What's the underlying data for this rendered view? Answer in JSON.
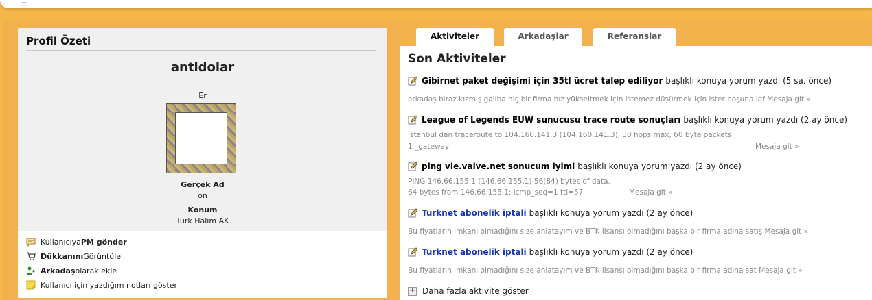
{
  "left_panel": {
    "title": "Profil Özeti",
    "username": "antidolar",
    "gender": "Er",
    "real_name_label": "Gerçek Ad",
    "real_name_value": "on",
    "location_label": "Konum",
    "location_value": "Türk Halim AK",
    "actions": [
      {
        "pre": "Kullanıcıya ",
        "bold": "PM gönder",
        "post": "",
        "icon": "message-icon"
      },
      {
        "pre": "",
        "bold": "Dükkanını",
        "post": " Görüntüle",
        "icon": "cart-icon"
      },
      {
        "pre": "",
        "bold": "Arkadaş",
        "post": " olarak ekle",
        "icon": "add-friend-icon"
      },
      {
        "pre": "Kullanıcı için yazdığım notları göster",
        "bold": "",
        "post": "",
        "icon": "note-icon"
      }
    ]
  },
  "tabs": [
    {
      "label": "Aktiviteler",
      "active": true
    },
    {
      "label": "Arkadaşlar",
      "active": false
    },
    {
      "label": "Referanslar",
      "active": false
    }
  ],
  "activity": {
    "title": "Son Aktiviteler",
    "items": [
      {
        "topic": "Gibirnet paket değişimi için 35tl ücret talep ediliyor",
        "suffix": "başlıklı konuya yorum yazdı (5 sa. önce)",
        "snippet": "arkadaş biraz kızmış galiba hiç bir firma hız yükseltmek için istemez düşürmek için ister boşuna laf Mesaja git »",
        "snippet2": "",
        "goto": ""
      },
      {
        "topic": "League of Legends EUW sunucusu trace route sonuçları",
        "suffix": "başlıklı konuya yorum yazdı (2 ay önce)",
        "snippet": "İstanbul dan traceroute to 104.160.141.3 (104.160.141.3), 30 hops max, 60 byte packets",
        "snippet2": "1 _gateway",
        "goto": "Mesaja git »"
      },
      {
        "topic": "ping vie.valve.net sonucum iyimi",
        "suffix": "başlıklı konuya yorum yazdı (2 ay önce)",
        "snippet": "PING 146.66.155.1 (146.66.155.1) 56(84) bytes of data.",
        "snippet2": "64 bytes from 146.66.155.1: icmp_seq=1 ttl=57",
        "goto": "Mesaja git »"
      },
      {
        "topic": "Turknet abonelik iptali",
        "suffix": "başlıklı konuya yorum yazdı (2 ay önce)",
        "snippet": "Bu fiyatların imkanı olmadığını size anlatayım ve BTK lisansı olmadığını başka bir firma adına satış Mesaja git »",
        "snippet2": "",
        "goto": ""
      },
      {
        "topic": "Turknet abonelik iptali",
        "suffix": "başlıklı konuya yorum yazdı (2 ay önce)",
        "snippet": "Bu fiyatların imkanı olmadığını size anlatayım ve BTK lisansı olmadığını başka bir firma adına sat Mesaja git »",
        "snippet2": "",
        "goto": ""
      }
    ],
    "more_label": "Daha fazla aktivite göster"
  },
  "colors": {
    "background": "#f5b64a",
    "link_blue": "#1a35b5",
    "snippet_gray": "#8a8a8a"
  }
}
